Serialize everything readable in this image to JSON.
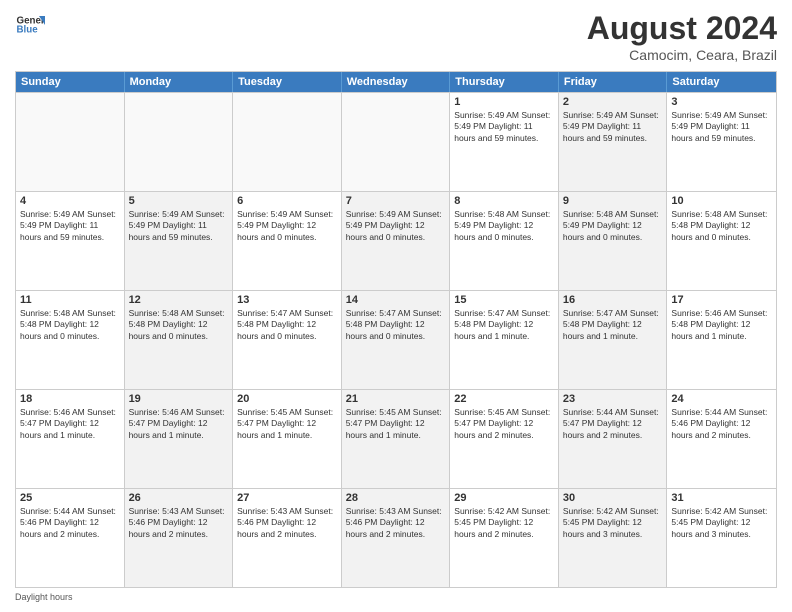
{
  "header": {
    "logo_line1": "General",
    "logo_line2": "Blue",
    "month_title": "August 2024",
    "subtitle": "Camocim, Ceara, Brazil"
  },
  "weekdays": [
    "Sunday",
    "Monday",
    "Tuesday",
    "Wednesday",
    "Thursday",
    "Friday",
    "Saturday"
  ],
  "footer": {
    "daylight_label": "Daylight hours"
  },
  "weeks": [
    [
      {
        "day": "",
        "info": "",
        "empty": true
      },
      {
        "day": "",
        "info": "",
        "empty": true
      },
      {
        "day": "",
        "info": "",
        "empty": true
      },
      {
        "day": "",
        "info": "",
        "empty": true
      },
      {
        "day": "1",
        "info": "Sunrise: 5:49 AM\nSunset: 5:49 PM\nDaylight: 11 hours\nand 59 minutes."
      },
      {
        "day": "2",
        "info": "Sunrise: 5:49 AM\nSunset: 5:49 PM\nDaylight: 11 hours\nand 59 minutes."
      },
      {
        "day": "3",
        "info": "Sunrise: 5:49 AM\nSunset: 5:49 PM\nDaylight: 11 hours\nand 59 minutes."
      }
    ],
    [
      {
        "day": "4",
        "info": "Sunrise: 5:49 AM\nSunset: 5:49 PM\nDaylight: 11 hours\nand 59 minutes."
      },
      {
        "day": "5",
        "info": "Sunrise: 5:49 AM\nSunset: 5:49 PM\nDaylight: 11 hours\nand 59 minutes."
      },
      {
        "day": "6",
        "info": "Sunrise: 5:49 AM\nSunset: 5:49 PM\nDaylight: 12 hours\nand 0 minutes."
      },
      {
        "day": "7",
        "info": "Sunrise: 5:49 AM\nSunset: 5:49 PM\nDaylight: 12 hours\nand 0 minutes."
      },
      {
        "day": "8",
        "info": "Sunrise: 5:48 AM\nSunset: 5:49 PM\nDaylight: 12 hours\nand 0 minutes."
      },
      {
        "day": "9",
        "info": "Sunrise: 5:48 AM\nSunset: 5:49 PM\nDaylight: 12 hours\nand 0 minutes."
      },
      {
        "day": "10",
        "info": "Sunrise: 5:48 AM\nSunset: 5:48 PM\nDaylight: 12 hours\nand 0 minutes."
      }
    ],
    [
      {
        "day": "11",
        "info": "Sunrise: 5:48 AM\nSunset: 5:48 PM\nDaylight: 12 hours\nand 0 minutes."
      },
      {
        "day": "12",
        "info": "Sunrise: 5:48 AM\nSunset: 5:48 PM\nDaylight: 12 hours\nand 0 minutes."
      },
      {
        "day": "13",
        "info": "Sunrise: 5:47 AM\nSunset: 5:48 PM\nDaylight: 12 hours\nand 0 minutes."
      },
      {
        "day": "14",
        "info": "Sunrise: 5:47 AM\nSunset: 5:48 PM\nDaylight: 12 hours\nand 0 minutes."
      },
      {
        "day": "15",
        "info": "Sunrise: 5:47 AM\nSunset: 5:48 PM\nDaylight: 12 hours\nand 1 minute."
      },
      {
        "day": "16",
        "info": "Sunrise: 5:47 AM\nSunset: 5:48 PM\nDaylight: 12 hours\nand 1 minute."
      },
      {
        "day": "17",
        "info": "Sunrise: 5:46 AM\nSunset: 5:48 PM\nDaylight: 12 hours\nand 1 minute."
      }
    ],
    [
      {
        "day": "18",
        "info": "Sunrise: 5:46 AM\nSunset: 5:47 PM\nDaylight: 12 hours\nand 1 minute."
      },
      {
        "day": "19",
        "info": "Sunrise: 5:46 AM\nSunset: 5:47 PM\nDaylight: 12 hours\nand 1 minute."
      },
      {
        "day": "20",
        "info": "Sunrise: 5:45 AM\nSunset: 5:47 PM\nDaylight: 12 hours\nand 1 minute."
      },
      {
        "day": "21",
        "info": "Sunrise: 5:45 AM\nSunset: 5:47 PM\nDaylight: 12 hours\nand 1 minute."
      },
      {
        "day": "22",
        "info": "Sunrise: 5:45 AM\nSunset: 5:47 PM\nDaylight: 12 hours\nand 2 minutes."
      },
      {
        "day": "23",
        "info": "Sunrise: 5:44 AM\nSunset: 5:47 PM\nDaylight: 12 hours\nand 2 minutes."
      },
      {
        "day": "24",
        "info": "Sunrise: 5:44 AM\nSunset: 5:46 PM\nDaylight: 12 hours\nand 2 minutes."
      }
    ],
    [
      {
        "day": "25",
        "info": "Sunrise: 5:44 AM\nSunset: 5:46 PM\nDaylight: 12 hours\nand 2 minutes."
      },
      {
        "day": "26",
        "info": "Sunrise: 5:43 AM\nSunset: 5:46 PM\nDaylight: 12 hours\nand 2 minutes."
      },
      {
        "day": "27",
        "info": "Sunrise: 5:43 AM\nSunset: 5:46 PM\nDaylight: 12 hours\nand 2 minutes."
      },
      {
        "day": "28",
        "info": "Sunrise: 5:43 AM\nSunset: 5:46 PM\nDaylight: 12 hours\nand 2 minutes."
      },
      {
        "day": "29",
        "info": "Sunrise: 5:42 AM\nSunset: 5:45 PM\nDaylight: 12 hours\nand 2 minutes."
      },
      {
        "day": "30",
        "info": "Sunrise: 5:42 AM\nSunset: 5:45 PM\nDaylight: 12 hours\nand 3 minutes."
      },
      {
        "day": "31",
        "info": "Sunrise: 5:42 AM\nSunset: 5:45 PM\nDaylight: 12 hours\nand 3 minutes."
      }
    ]
  ]
}
